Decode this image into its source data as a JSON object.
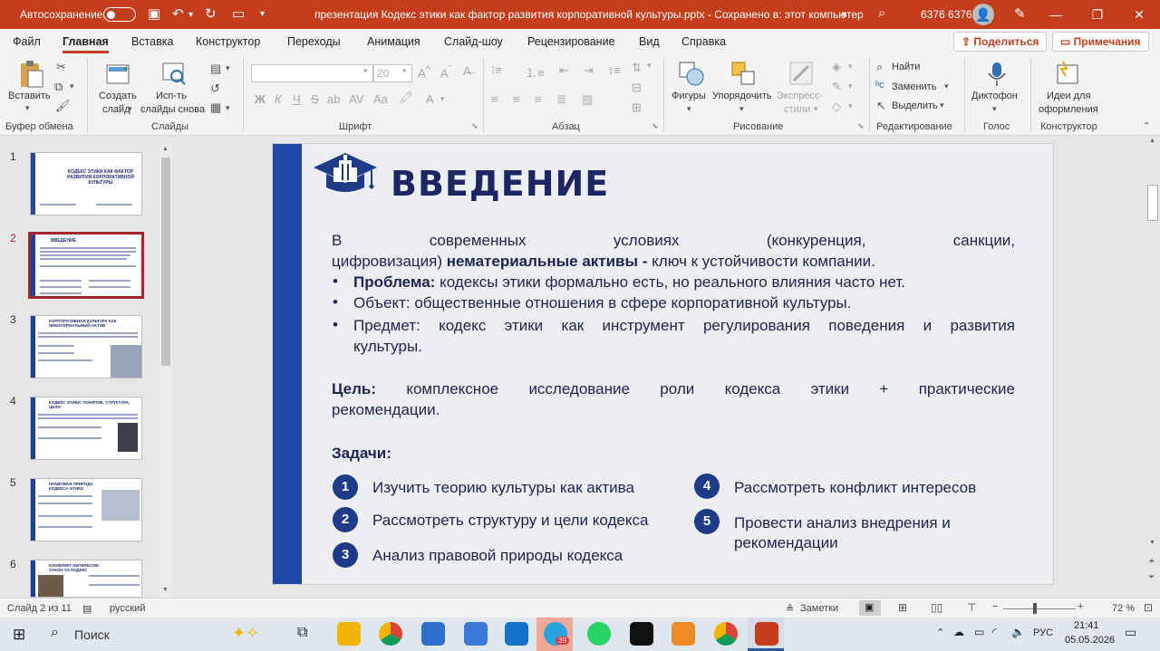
{
  "titlebar": {
    "autosave_label": "Автосохранение",
    "doc_title": "презентация Кодекс этики как фактор развития корпоративной культуры.pptx  -  Сохранено в: этот компьютер",
    "user_name": "6376 6376",
    "minimize": "—",
    "restore": "❐",
    "close": "✕"
  },
  "menu": {
    "tabs": [
      "Файл",
      "Главная",
      "Вставка",
      "Конструктор",
      "Переходы",
      "Анимация",
      "Слайд-шоу",
      "Рецензирование",
      "Вид",
      "Справка"
    ],
    "share": "Поделиться",
    "comments": "Примечания"
  },
  "ribbon": {
    "paste": "Вставить",
    "new_slide_1": "Создать",
    "new_slide_2": "слайд",
    "reuse_1": "Исп-ть",
    "reuse_2": "слайды снова",
    "font_size": "20",
    "bold": "Ж",
    "italic": "К",
    "underline": "Ч",
    "strike": "S",
    "shapes": "Фигуры",
    "arrange": "Упорядочить",
    "quick_styles_1": "Экспресс-",
    "quick_styles_2": "стили",
    "find": "Найти",
    "replace": "Заменить",
    "select": "Выделить",
    "dictate": "Диктофон",
    "designer_1": "Идеи для",
    "designer_2": "оформления",
    "groups": {
      "clipboard": "Буфер обмена",
      "slides": "Слайды",
      "font": "Шрифт",
      "paragraph": "Абзац",
      "drawing": "Рисование",
      "editing": "Редактирование",
      "voice": "Голос",
      "designer": "Конструктор"
    }
  },
  "thumbnails": {
    "numbers": [
      "1",
      "2",
      "3",
      "4",
      "5",
      "6"
    ],
    "t1_title": "КОДЕКС ЭТИКИ КАК ФАКТОР РАЗВИТИЯ КОРПОРАТИВНОЙ КУЛЬТУРЫ",
    "t2_title": "ВВЕДЕНИЕ",
    "t3_title": "КОРПОРАТИВНАЯ КУЛЬТУРА КАК НЕМАТЕРИАЛЬНЫЙ АКТИВ",
    "t4_title": "КОДЕКС ЭТИКИ: ПОНЯТИЕ, СТРУКТУРА, ЦЕЛИ",
    "t5_title": "ПРАВОВАЯ ПРИРОДА КОДЕКСА ЭТИКИ",
    "t6_title": "КОНФЛИКТ ИНТЕРЕСОВ: ЗАКОН VS КОДЕКС"
  },
  "slide": {
    "title": "ВВЕДЕНИЕ",
    "intro_line1": "В современных условиях (конкуренция, санкции,",
    "intro_line2_a": "цифровизация) ",
    "intro_line2_bold": "нематериальные активы",
    "intro_line2_b": " - ключ к устойчивости компании.",
    "bullet1_bold": "Проблема:",
    "bullet1_text": " кодексы этики формально есть, но реального влияния часто нет.",
    "bullet2_text": "Объект: общественные отношения в сфере корпоративной культуры.",
    "bullet3_line1": "Предмет: кодекс этики как инструмент регулирования поведения и развития",
    "bullet3_line2": "культуры.",
    "goal_bold": "Цель:",
    "goal_line1_rest": " комплексное исследование роли кодекса этики + практические",
    "goal_line2": "рекомендации.",
    "tasks_title": "Задачи:",
    "tasks": [
      {
        "num": "1",
        "text": "Изучить теорию культуры как актива"
      },
      {
        "num": "2",
        "text": "Рассмотреть  структуру и цели кодекса"
      },
      {
        "num": "3",
        "text": "Анализ правовой природы кодекса"
      },
      {
        "num": "4",
        "text": "Рассмотреть конфликт интересов"
      },
      {
        "num": "5",
        "text_line1": "Провести анализ внедрения и",
        "text_line2": "рекомендации"
      }
    ]
  },
  "status": {
    "slide_counter": "Слайд 2 из 11",
    "language": "русский",
    "notes": "Заметки",
    "zoom": "72 %"
  },
  "taskbar": {
    "search": "Поиск",
    "lang": "РУС",
    "time": "21:41",
    "date": "05.05.2026",
    "telegram_badge": "39"
  },
  "colors": {
    "accent": "#c43e1c",
    "slide_bar": "#1e48a8",
    "slide_title": "#1b2663",
    "task_circle": "#1f3a86"
  }
}
